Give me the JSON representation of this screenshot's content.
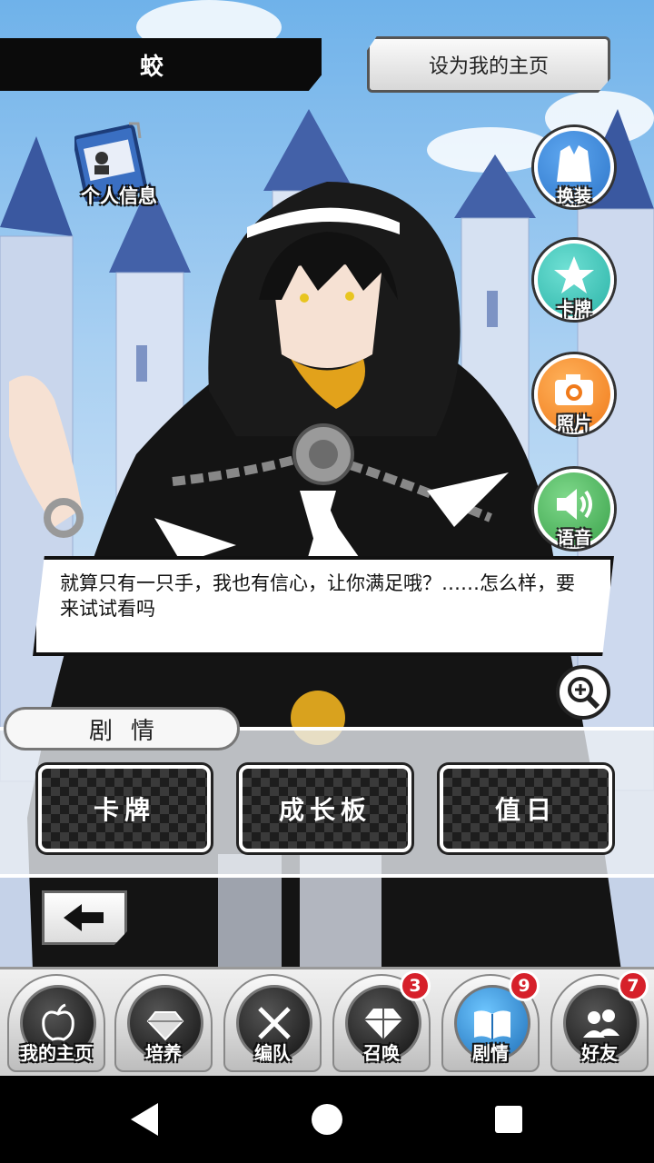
{
  "header": {
    "character_name": "蛟",
    "set_home_label": "设为我的主页"
  },
  "profile": {
    "label": "个人信息",
    "icon": "id-card-icon"
  },
  "side_menu": [
    {
      "label": "换装",
      "icon": "outfit-icon",
      "color": "#2e76c9"
    },
    {
      "label": "卡牌",
      "icon": "star-card-icon",
      "color": "#2bb3a7"
    },
    {
      "label": "照片",
      "icon": "camera-icon",
      "color": "#f07a1a"
    },
    {
      "label": "语音",
      "icon": "speaker-icon",
      "color": "#3aa14a"
    }
  ],
  "dialogue": {
    "text": "就算只有一只手，我也有信心，让你满足哦？……怎么样，要来试试看吗"
  },
  "story_panel": {
    "tab_label": "剧情",
    "buttons": [
      "卡牌",
      "成长板",
      "值日"
    ]
  },
  "bottom_tabs": [
    {
      "label": "我的主页",
      "icon": "apple-icon",
      "badge": ""
    },
    {
      "label": "培养",
      "icon": "gem-cluster-icon",
      "badge": ""
    },
    {
      "label": "编队",
      "icon": "crossed-swords-icon",
      "badge": ""
    },
    {
      "label": "召唤",
      "icon": "diamond-icon",
      "badge": "3"
    },
    {
      "label": "剧情",
      "icon": "book-icon",
      "badge": "9"
    },
    {
      "label": "好友",
      "icon": "friends-icon",
      "badge": "7"
    }
  ],
  "colors": {
    "accent": "#d6202a",
    "active_tab": "#1f6fb8"
  }
}
